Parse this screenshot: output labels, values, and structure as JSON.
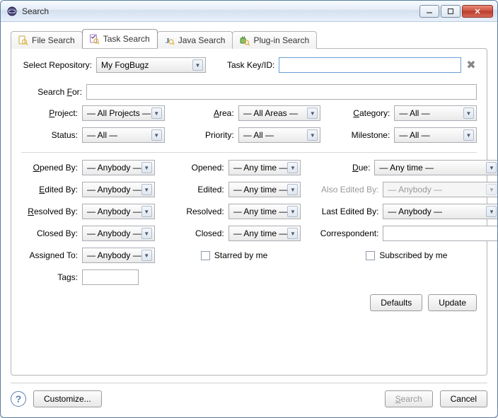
{
  "window": {
    "title": "Search"
  },
  "tabs": [
    {
      "label": "File Search"
    },
    {
      "label": "Task Search"
    },
    {
      "label": "Java Search"
    },
    {
      "label": "Plug-in Search"
    }
  ],
  "top": {
    "repoLabel": "Select Repository:",
    "repoValue": "My FogBugz",
    "taskKeyLabel": "Task Key/ID:",
    "taskKeyValue": ""
  },
  "searchFor": {
    "label": "Search For:",
    "value": ""
  },
  "filters1": {
    "project": {
      "label": "Project:",
      "value": "— All Projects —"
    },
    "status": {
      "label": "Status:",
      "value": "— All —"
    },
    "area": {
      "label": "Area:",
      "value": "— All Areas —"
    },
    "priority": {
      "label": "Priority:",
      "value": "— All —"
    },
    "category": {
      "label": "Category:",
      "value": "— All —"
    },
    "milestone": {
      "label": "Milestone:",
      "value": "— All —"
    }
  },
  "filters2": {
    "openedBy": {
      "label": "Opened By:",
      "value": "— Anybody —"
    },
    "editedBy": {
      "label": "Edited By:",
      "value": "— Anybody —"
    },
    "resolvedBy": {
      "label": "Resolved By:",
      "value": "— Anybody —"
    },
    "closedBy": {
      "label": "Closed By:",
      "value": "— Anybody —"
    },
    "assignedTo": {
      "label": "Assigned To:",
      "value": "— Anybody —"
    },
    "tags": {
      "label": "Tags:",
      "value": ""
    },
    "opened": {
      "label": "Opened:",
      "value": "— Any time —"
    },
    "edited": {
      "label": "Edited:",
      "value": "— Any time —"
    },
    "resolved": {
      "label": "Resolved:",
      "value": "— Any time —"
    },
    "closed": {
      "label": "Closed:",
      "value": "— Any time —"
    },
    "starred": {
      "label": "Starred by me"
    },
    "due": {
      "label": "Due:",
      "value": "— Any time —"
    },
    "alsoEditedBy": {
      "label": "Also Edited By:",
      "value": "— Anybody —"
    },
    "lastEditedBy": {
      "label": "Last Edited By:",
      "value": "— Anybody —"
    },
    "correspondent": {
      "label": "Correspondent:",
      "value": ""
    },
    "subscribed": {
      "label": "Subscribed by me"
    }
  },
  "buttons": {
    "defaults": "Defaults",
    "update": "Update",
    "customize": "Customize...",
    "search": "Search",
    "cancel": "Cancel"
  }
}
